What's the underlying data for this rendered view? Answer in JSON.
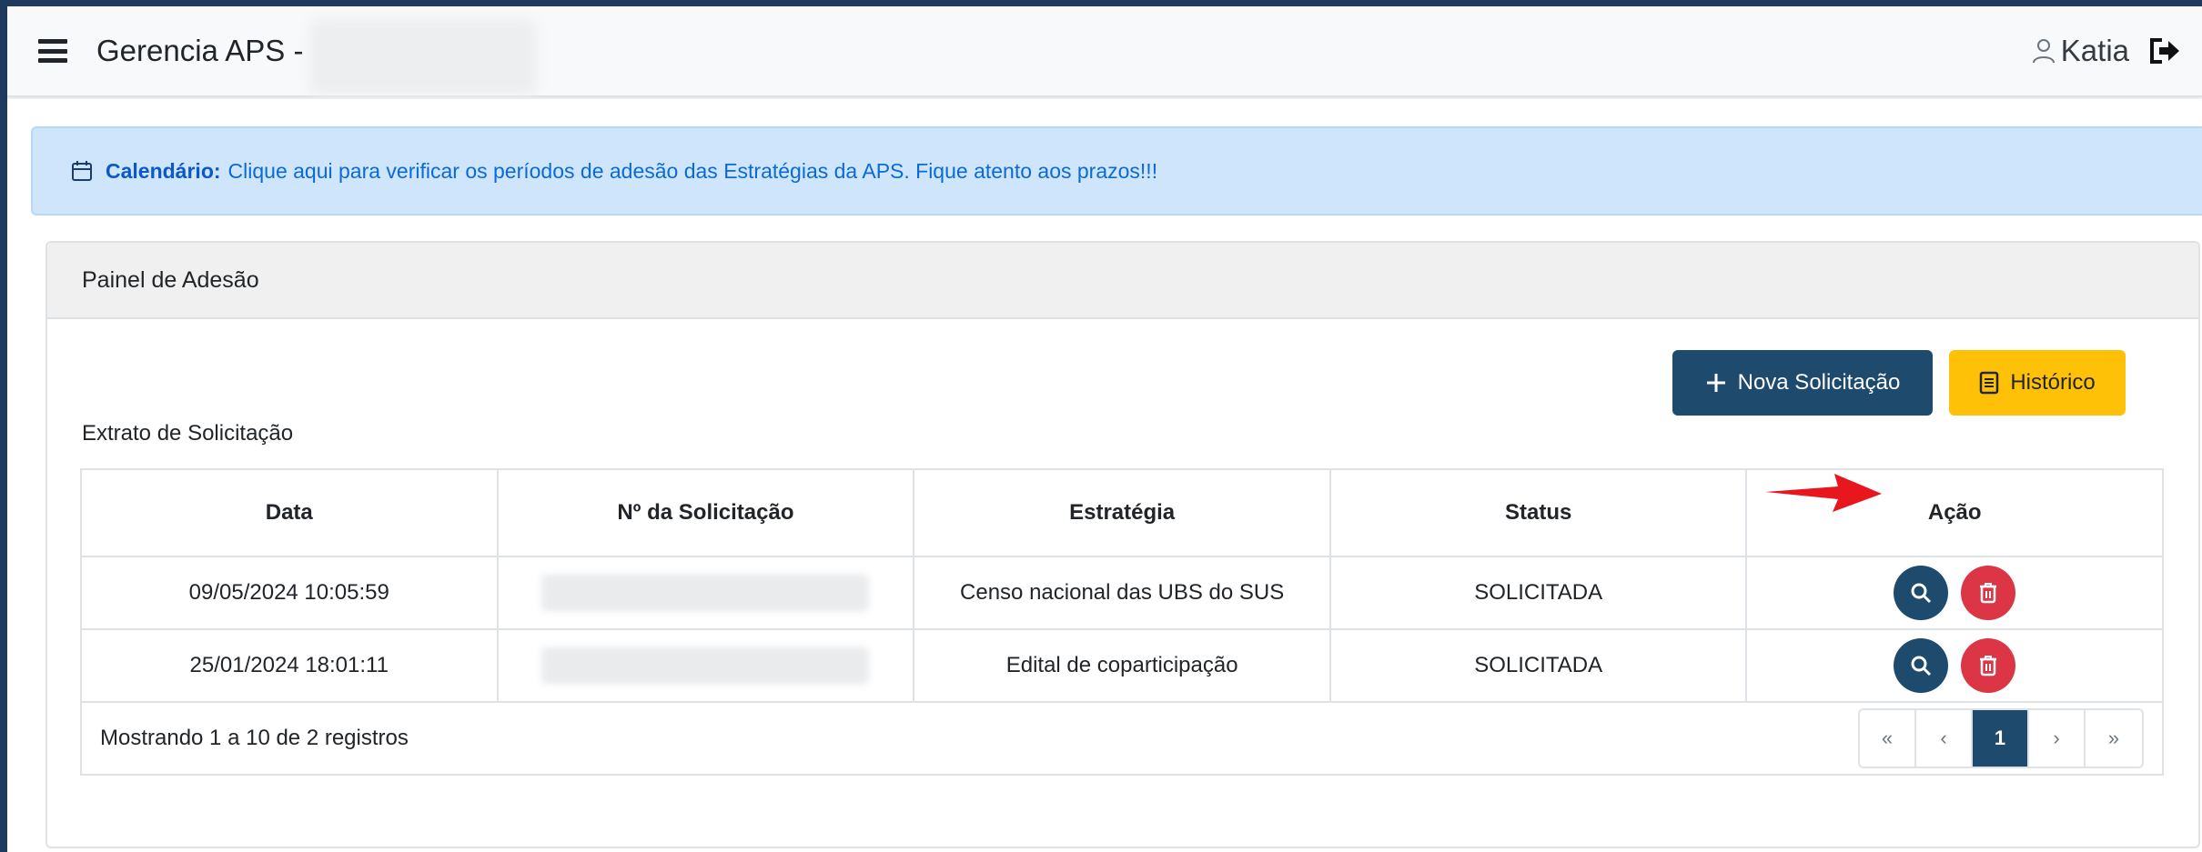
{
  "header": {
    "title": "Gerencia APS -",
    "user_name": "Katia"
  },
  "alert": {
    "bold": "Calendário:",
    "text": "Clique aqui para verificar os períodos de adesão das Estratégias da APS. Fique atento aos prazos!!!"
  },
  "panel": {
    "title": "Painel de Adesão",
    "nova_label": "Nova Solicitação",
    "historico_label": "Histórico",
    "extrato_label": "Extrato de Solicitação"
  },
  "table": {
    "columns": [
      "Data",
      "Nº da Solicitação",
      "Estratégia",
      "Status",
      "Ação"
    ],
    "rows": [
      {
        "data": "09/05/2024 10:05:59",
        "estrategia": "Censo nacional das UBS do SUS",
        "status": "SOLICITADA"
      },
      {
        "data": "25/01/2024 18:01:11",
        "estrategia": "Edital de coparticipação",
        "status": "SOLICITADA"
      }
    ],
    "footer_text": "Mostrando 1 a 10 de 2 registros"
  },
  "pagination": {
    "first": "«",
    "prev": "‹",
    "current": "1",
    "next": "›",
    "last": "»"
  },
  "colors": {
    "primary": "#1e4a6e",
    "warning": "#ffc107",
    "danger": "#dc3545",
    "alert_bg": "#cfe5fc",
    "arrow": "#e8161d"
  },
  "icons": [
    "menu-icon",
    "user-icon",
    "logout-icon",
    "calendar-icon",
    "plus-icon",
    "document-icon",
    "search-icon",
    "trash-icon"
  ]
}
